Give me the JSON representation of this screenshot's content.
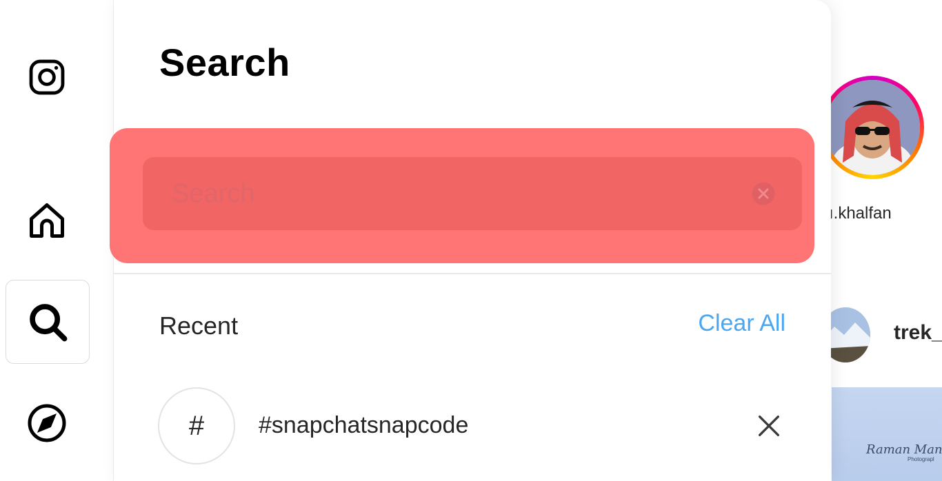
{
  "nav": {
    "icons": [
      "instagram-logo-icon",
      "home-icon",
      "search-icon",
      "explore-compass-icon"
    ]
  },
  "search_panel": {
    "title": "Search",
    "search": {
      "placeholder": "Search",
      "value": ""
    },
    "recent": {
      "heading": "Recent",
      "clear_all_label": "Clear All",
      "items": [
        {
          "type": "hashtag",
          "symbol": "#",
          "text": "#snapchatsnapcode"
        }
      ]
    }
  },
  "feed_background": {
    "story_username_partial": "ı.khalfan",
    "post_username_partial": "trek_",
    "post_watermark": "Raman Man C",
    "post_watermark_sub": "Photograpl"
  },
  "colors": {
    "highlight": "#ff7474",
    "link_blue": "#4aa6f0",
    "text_dark": "#262626"
  }
}
